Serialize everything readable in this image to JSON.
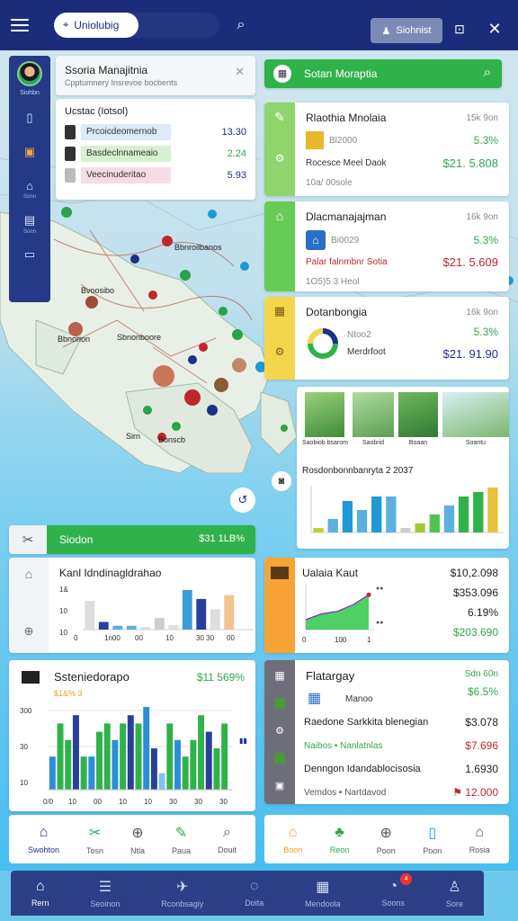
{
  "topbar": {
    "search_value": "Uniolubig",
    "button_label": "Siohnist",
    "colors": {
      "bar": "#1b2d7a"
    }
  },
  "sidebar": {
    "user_label": "Siohbn",
    "items": [
      {
        "icon": "phone-icon",
        "label": ""
      },
      {
        "icon": "grid-icon",
        "label": ""
      },
      {
        "icon": "home-icon",
        "label": "Sonn"
      },
      {
        "icon": "chart-icon",
        "label": "Sonn"
      },
      {
        "icon": "monitor-icon",
        "label": ""
      }
    ]
  },
  "overview_card": {
    "title": "Ssoria Manajitnia",
    "subtitle": "Cpptumnery Insrevoe bocbents",
    "section_label": "Ucstac (Iotsol)",
    "rows": [
      {
        "label": "Prcoicdeomernob",
        "value": "13.30"
      },
      {
        "label": "Basdeclnnameaio",
        "value": "2.24"
      },
      {
        "label": "Veecinuderitao",
        "value": "5.93"
      }
    ]
  },
  "right_header": {
    "title": "Sotan Moraptia"
  },
  "property_cards": [
    {
      "title": "Rlaothia Mnolaia",
      "price_top": "15k 9on",
      "change": "5.3%",
      "sub": "Bl2000",
      "line": "Rocesce Meel Daok",
      "amount": "$21. 5.808",
      "note": "10a/ 00sole",
      "amount_color": "#2fa84a",
      "stripe": "#8ed66b"
    },
    {
      "title": "Dlacmanajajman",
      "price_top": "16k 9on",
      "change": "5.3%",
      "sub": "Bi0029",
      "line": "Palar falnmbnr Sotia",
      "amount": "$21. 5.609",
      "note": "1O5)5 3 Heol",
      "amount_color": "#c0262e",
      "stripe": "#66cc55"
    },
    {
      "title": "Dotanbongia",
      "price_top": "16k 9on",
      "change": "5.3%",
      "sub": "Ntoo2",
      "line": "Merdrfoot",
      "amount": "$21. 91.90",
      "note": "",
      "amount_color": "#1d2f8a",
      "stripe": "#f5d64a"
    }
  ],
  "gallery_card": {
    "captions": [
      "Saobiob bsarom",
      "Saobrid",
      "Boaan",
      "Soantu"
    ],
    "chart_title": "Rosdonbonnbanryta 2 2037"
  },
  "left_strip": {
    "title": "Siodon",
    "value": "$31 1LB%"
  },
  "bar_card": {
    "title": "Kanl Idndinagldrahao"
  },
  "line_card": {
    "title": "Ualaia Kaut",
    "values": [
      "$10,2.098",
      "$353.096",
      "6.19%",
      "$203.690"
    ]
  },
  "stats_card": {
    "title": "Ssteniedorapo",
    "value": "$11 569%",
    "sub": "$1&% 3"
  },
  "listing_card": {
    "title": "Flatargay",
    "top_value": "Sdn 60n",
    "percent": "$6.5%",
    "sub": "Manoo",
    "rows": [
      {
        "label": "Raedone Sarkkita blenegian",
        "value": "$3.078",
        "color": "#1d1d1d"
      },
      {
        "label": "Naibos • Nanlatnlas",
        "value": "$7.696",
        "color": "#c0262e"
      },
      {
        "label": "Denngon Idandablocisosia",
        "value": "1.6930",
        "color": "#1d1d1d"
      },
      {
        "label": "Vemdos • Nartdavod",
        "value": "12.000",
        "color": "#c0262e"
      }
    ]
  },
  "left_tabs": [
    {
      "icon": "home-icon",
      "label": "Swohton"
    },
    {
      "icon": "tools-icon",
      "label": "Tosn"
    },
    {
      "icon": "circle-plus-icon",
      "label": "Ntla"
    },
    {
      "icon": "pen-icon",
      "label": "Paua"
    },
    {
      "icon": "search-icon",
      "label": "Douit"
    }
  ],
  "right_tabs": [
    {
      "icon": "home-icon",
      "label": "Boon"
    },
    {
      "icon": "leaf-icon",
      "label": "Reon"
    },
    {
      "icon": "circle-plus-icon",
      "label": "Poon"
    },
    {
      "icon": "doc-icon",
      "label": "Poon"
    },
    {
      "icon": "house-icon",
      "label": "Rosia"
    }
  ],
  "bottom_nav": [
    {
      "icon": "home-icon",
      "label": "Rern",
      "active": true
    },
    {
      "icon": "list-icon",
      "label": "Seoinon"
    },
    {
      "icon": "megaphone-icon",
      "label": "Rconbsagiy"
    },
    {
      "icon": "leaf-icon",
      "label": "Doita"
    },
    {
      "icon": "building-icon",
      "label": "Mendoola"
    },
    {
      "icon": "bell-icon",
      "label": "Soons",
      "badge": "4"
    },
    {
      "icon": "user-icon",
      "label": "Sore"
    }
  ],
  "chart_data": [
    {
      "type": "bar",
      "title": "Rosdonbonnbanryta 2 2037",
      "categories": [
        "c1",
        "c2",
        "c3",
        "c4",
        "c5",
        "c6",
        "c7",
        "c8",
        "c9",
        "c10",
        "c11",
        "c12",
        "c13"
      ],
      "values": [
        1,
        3,
        7,
        5,
        8,
        8,
        1,
        2,
        4,
        6,
        8,
        9,
        10
      ],
      "colors": [
        "#b8d23a",
        "#5bb0df",
        "#1f9ad6",
        "#5bb0df",
        "#1f9ad6",
        "#5bb0df",
        "#ccc",
        "#9bcc32",
        "#4fc34f",
        "#5bb0df",
        "#2fb24a",
        "#2fb24a",
        "#e6c23a"
      ]
    },
    {
      "type": "bar",
      "title": "Kanl Idndinagldrahao",
      "categories": [
        "c1",
        "c2",
        "c3",
        "c4",
        "c5",
        "c6",
        "c7",
        "c8",
        "c9",
        "c10",
        "c11",
        "c12"
      ],
      "values": [
        4.5,
        1.2,
        0.6,
        0.6,
        0.4,
        1.8,
        0.7,
        6.2,
        4.8,
        3.2,
        5.4,
        0
      ],
      "colors": [
        "#ddd",
        "#2a3f99",
        "#5ab0dd",
        "#5ab0dd",
        "#ddd",
        "#ccc",
        "#ddd",
        "#3c9ad6",
        "#2a3f99",
        "#ddd",
        "#f2c38f",
        "#fff"
      ],
      "tick_labels": [
        "1&",
        "10",
        "10"
      ],
      "x_labels": [
        "0",
        "1n00",
        "00",
        "10",
        "30 30",
        "00"
      ]
    },
    {
      "type": "area",
      "title": "Ualaia Kaut",
      "x": [
        0,
        1,
        2,
        3,
        4
      ],
      "y": [
        1.2,
        1.9,
        2.2,
        3.0,
        4.2
      ],
      "ylim": [
        0,
        5
      ],
      "x_labels": [
        "0",
        "100",
        "1"
      ]
    },
    {
      "type": "bar",
      "title": "Ssteniedorapo",
      "y_ticks": [
        "300",
        "30",
        "10"
      ],
      "x_labels": [
        "0/0",
        "10",
        "00",
        "10",
        "10",
        "30",
        "30",
        "30"
      ],
      "values": [
        4,
        8,
        6,
        9,
        4,
        4,
        7,
        8,
        6,
        8,
        9,
        8,
        10,
        5,
        2,
        8,
        6,
        4,
        6,
        9,
        7,
        5,
        8
      ],
      "colors": [
        "#2a8fd8",
        "#2fb24a",
        "#2fb24a",
        "#2a3f99",
        "#2fb24a",
        "#2a8fd8",
        "#2fb24a",
        "#2fb24a",
        "#2a8fd8",
        "#2fb24a",
        "#2a3f99",
        "#2fb24a",
        "#2a8fd8",
        "#2a3f99",
        "#7cc4ec",
        "#2fb24a",
        "#2a8fd8",
        "#2fb24a",
        "#2fb24a",
        "#2fb24a",
        "#2a3f99",
        "#2fb24a",
        "#2fb24a"
      ]
    }
  ]
}
